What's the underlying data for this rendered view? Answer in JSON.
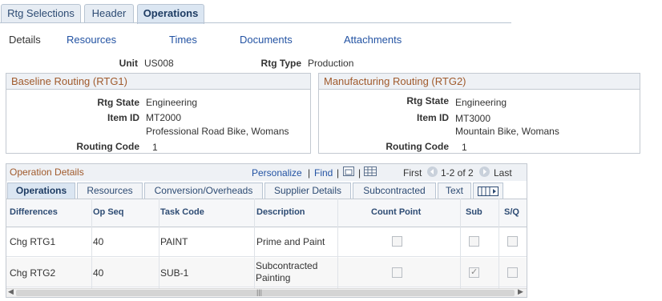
{
  "page_tabs": [
    {
      "label": "Rtg Selections",
      "active": false
    },
    {
      "label": "Header",
      "active": false
    },
    {
      "label": "Operations",
      "active": true
    }
  ],
  "sub_links": [
    "Details",
    "Resources",
    "Times",
    "Documents",
    "Attachments"
  ],
  "unit": {
    "label": "Unit",
    "value": "US008"
  },
  "rtg_type": {
    "label": "Rtg Type",
    "value": "Production"
  },
  "baseline": {
    "title": "Baseline Routing (RTG1)",
    "rtg_state_label": "Rtg State",
    "rtg_state": "Engineering",
    "item_id_label": "Item ID",
    "item_id": "MT2000",
    "item_desc": "Professional Road Bike, Womans",
    "routing_code_label": "Routing Code",
    "routing_code": "1"
  },
  "manufacturing": {
    "title": "Manufacturing Routing (RTG2)",
    "rtg_state_label": "Rtg State",
    "rtg_state": "Engineering",
    "item_id_label": "Item ID",
    "item_id": "MT3000",
    "item_desc": "Mountain Bike, Womans",
    "routing_code_label": "Routing Code",
    "routing_code": "1"
  },
  "grid": {
    "title": "Operation Details",
    "personalize": "Personalize",
    "separator": "|",
    "find": "Find",
    "first": "First",
    "range": "1-2 of 2",
    "last": "Last",
    "tabs": [
      "Operations",
      "Resources",
      "Conversion/Overheads",
      "Supplier Details",
      "Subcontracted",
      "Text"
    ],
    "columns": [
      "Differences",
      "Op Seq",
      "Task Code",
      "Description",
      "Count Point",
      "Sub",
      "S/Q"
    ],
    "rows": [
      {
        "differences": "Chg RTG1",
        "op_seq": "40",
        "task_code": "PAINT",
        "description": "Prime and Paint",
        "count_point": false,
        "sub": false,
        "sq": false
      },
      {
        "differences": "Chg RTG2",
        "op_seq": "40",
        "task_code": "SUB-1",
        "description": "Subcontracted Painting",
        "count_point": false,
        "sub": true,
        "sq": false
      }
    ]
  },
  "colors": {
    "link": "#2353a3",
    "group_title": "#a05a2c",
    "header_bg": "#eef1f5"
  }
}
